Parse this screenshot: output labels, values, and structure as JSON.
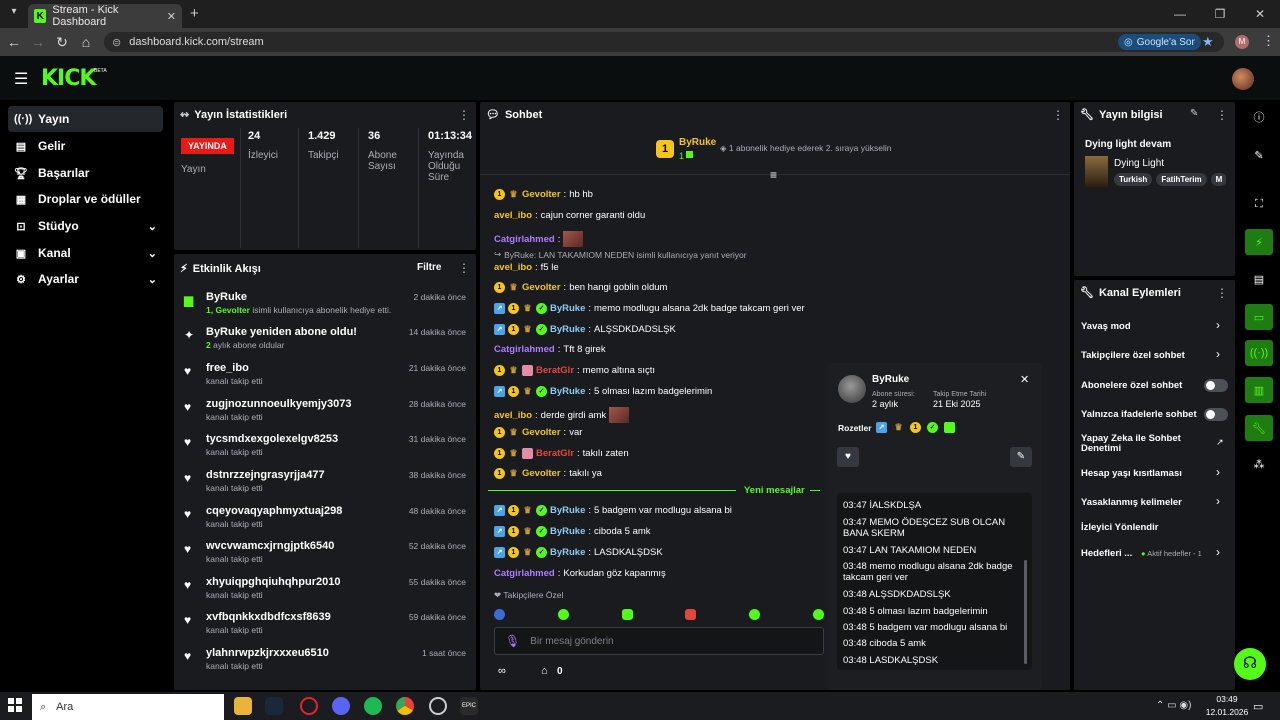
{
  "browser": {
    "tab_title": "Stream - Kick Dashboard",
    "url": "dashboard.kick.com/stream",
    "google_sor": "Google'a Sor",
    "profile_initial": "M"
  },
  "kick": {
    "logo": "KICK",
    "beta": "BETA"
  },
  "sidebar": {
    "items": [
      {
        "label": "Yayın",
        "icon": "broadcast-icon"
      },
      {
        "label": "Gelir",
        "icon": "revenue-icon"
      },
      {
        "label": "Başarılar",
        "icon": "trophy-icon"
      },
      {
        "label": "Droplar ve ödüller",
        "icon": "gift-icon"
      },
      {
        "label": "Stüdyo",
        "icon": "studio-icon"
      },
      {
        "label": "Kanal",
        "icon": "channel-icon"
      },
      {
        "label": "Ayarlar",
        "icon": "settings-icon"
      }
    ]
  },
  "stats": {
    "title": "Yayın İstatistikleri",
    "live_label": "YAYINDA",
    "status_label": "Yayın",
    "viewers": "24",
    "viewers_label": "İzleyici",
    "followers": "1.429",
    "followers_label": "Takipçi",
    "subs": "36",
    "subs_label": "Abone Sayısı",
    "duration": "01:13:34",
    "duration_label": "Yayında Olduğu Süre"
  },
  "activity": {
    "title": "Etkinlik Akışı",
    "filter": "Filtre",
    "items": [
      {
        "name": "ByRuke",
        "sub_prefix": "1, ",
        "sub_user": "Gevolter",
        "sub_suffix": " isimli kullanıcıya abonelik hediye etti.",
        "time": "2 dakika önce",
        "icon": "gift-icon"
      },
      {
        "name": "ByRuke yeniden abone oldu!",
        "sub_prefix": "2",
        "sub_user": "",
        "sub_suffix": " aylık abone oldular",
        "time": "14 dakika önce",
        "icon": "sparkle-icon"
      },
      {
        "name": "free_ibo",
        "sub_suffix": "kanalı takip etti",
        "time": "21 dakika önce",
        "icon": "heart-icon"
      },
      {
        "name": "zugjnozunnoeulkyemjy3073",
        "sub_suffix": "kanalı takip etti",
        "time": "28 dakika önce",
        "icon": "heart-icon"
      },
      {
        "name": "tycsmdxexgolexelgv8253",
        "sub_suffix": "kanalı takip etti",
        "time": "31 dakika önce",
        "icon": "heart-icon"
      },
      {
        "name": "dstnrzzejngrasyrjja477",
        "sub_suffix": "kanalı takip etti",
        "time": "38 dakika önce",
        "icon": "heart-icon"
      },
      {
        "name": "cqeyovaqyaphmyxtuaj298",
        "sub_suffix": "kanalı takip etti",
        "time": "48 dakika önce",
        "icon": "heart-icon"
      },
      {
        "name": "wvcvwamcxjrngjptk6540",
        "sub_suffix": "kanalı takip etti",
        "time": "52 dakika önce",
        "icon": "heart-icon"
      },
      {
        "name": "xhyuiqpghqiuhqhpur2010",
        "sub_suffix": "kanalı takip etti",
        "time": "55 dakika önce",
        "icon": "heart-icon"
      },
      {
        "name": "xvfbqnkkxdbdfcxsf8639",
        "sub_suffix": "kanalı takip etti",
        "time": "59 dakika önce",
        "icon": "heart-icon"
      },
      {
        "name": "ylahnrwpzkjrxxxeu6510",
        "sub_suffix": "kanalı takip etti",
        "time": "1 saat önce",
        "icon": "heart-icon"
      }
    ]
  },
  "chat": {
    "title": "Sohbet",
    "pinned_user": "ByRuke",
    "pinned_count": "1",
    "pinned_note": "1 abonelik hediye ederek 2. sıraya yükselin",
    "messages": [
      {
        "user": "Gevolter",
        "text": "hb hb",
        "badges": [
          "one",
          "crown"
        ],
        "color": "#f3c51d"
      },
      {
        "user": "avel_ibo",
        "text": "cajun corner garanti oldu",
        "badges": [],
        "color": "#f3c51d"
      },
      {
        "user": "Catgirlahmed",
        "text": "",
        "badges": [],
        "color": "#b07cff",
        "emote": true
      },
      {
        "reply": "ByRuke: LAN TAKAMIOM NEDEN isimli kullanıcıya yanıt veriyor"
      },
      {
        "user": "avel_ibo",
        "text": "f5 le",
        "badges": [],
        "color": "#f3c51d"
      },
      {
        "user": "Gevolter",
        "text": "ben hangi goblin oldum",
        "badges": [
          "one",
          "crown"
        ],
        "color": "#f3c51d"
      },
      {
        "user": "ByRuke",
        "text": "memo modlugu alsana 2dk badge takcam geri ver",
        "badges": [
          "vip",
          "one",
          "crown",
          "ver"
        ],
        "color": "#8ecbf5"
      },
      {
        "user": "ByRuke",
        "text": "ALŞSDKDADSLŞK",
        "badges": [
          "vip",
          "one",
          "crown",
          "ver"
        ],
        "color": "#8ecbf5"
      },
      {
        "user": "Catgirlahmed",
        "text": "Tft 8 girek",
        "badges": [],
        "color": "#b07cff"
      },
      {
        "user": "BeratGlr",
        "text": "memo altına sıçtı",
        "badges": [
          "one",
          "crown",
          "gift"
        ],
        "color": "#e0483f"
      },
      {
        "user": "ByRuke",
        "text": "5 olması lazım badgelerimin",
        "badges": [
          "vip",
          "one",
          "crown",
          "ver"
        ],
        "color": "#8ecbf5"
      },
      {
        "user": "avel_ibo",
        "text": "derde girdi amk",
        "badges": [],
        "color": "#f3c51d",
        "emote_after": true
      },
      {
        "user": "Gevolter",
        "text": "var",
        "badges": [
          "one",
          "crown"
        ],
        "color": "#f3c51d"
      },
      {
        "user": "BeratGlr",
        "text": "takılı zaten",
        "badges": [
          "one",
          "crown",
          "gift"
        ],
        "color": "#e0483f"
      },
      {
        "user": "Gevolter",
        "text": "takılı ya",
        "badges": [
          "one",
          "crown"
        ],
        "color": "#f3c51d"
      }
    ],
    "new_label": "Yeni mesajlar",
    "new_messages": [
      {
        "user": "ByRuke",
        "text": "5 badgem var modlugu alsana bi",
        "badges": [
          "vip",
          "one",
          "crown",
          "ver"
        ],
        "color": "#8ecbf5"
      },
      {
        "user": "ByRuke",
        "text": "ciboda 5 amk",
        "badges": [
          "vip",
          "one",
          "crown",
          "ver"
        ],
        "color": "#8ecbf5"
      },
      {
        "user": "ByRuke",
        "text": "LASDKALŞDSK",
        "badges": [
          "vip",
          "one",
          "crown",
          "ver"
        ],
        "color": "#8ecbf5"
      },
      {
        "user": "Catgirlahmed",
        "text": "Korkudan göz kapanmış",
        "badges": [],
        "color": "#b07cff"
      }
    ],
    "followers_only_label": "Takipçilere Özel",
    "input_placeholder": "Bir mesaj gönderin",
    "points": "0"
  },
  "popup": {
    "username": "ByRuke",
    "sub_label": "Abone süresi:",
    "sub_value": "2 aylık",
    "follow_label": "Takip Etme Tarihi",
    "follow_value": "21 Eki 2025",
    "badges_label": "Rozetler",
    "log": [
      "03:47 İALSKDLŞA",
      "03:47 MEMO ÖDEŞCEZ SUB OLCAN BANA SKERM",
      "03:47 LAN TAKAMIOM NEDEN",
      "03:48 memo modlugu alsana 2dk badge takcam geri ver",
      "03:48 ALŞSDKDADSLŞK",
      "03:48 5 olması lazım badgelerimin",
      "03:48 5 badgem var modlugu alsana bi",
      "03:48 ciboda 5 amk",
      "03:48 LASDKALŞDSK"
    ]
  },
  "stream_info": {
    "title": "Yayın bilgisi",
    "stream_title": "Dying light devam",
    "category": "Dying Light",
    "tags": [
      "Turkish",
      "FatihTerim",
      "M"
    ]
  },
  "channel_actions": {
    "title": "Kanal Eylemleri",
    "slow_mode": "Yavaş mod",
    "followers_only": "Takipçilere özel sohbet",
    "subs_only": "Abonelere özel sohbet",
    "emotes_only": "Yalnızca ifadelerle sohbet",
    "ai_moderation": "Yapay Zeka ile Sohbet Denetimi",
    "age_limits": "Hesap yaşı kısıtlaması",
    "banned_words": "Yasaklanmış kelimeler",
    "viewer_redirect": "İzleyici Yönlendir",
    "goals": "Hedefleri ...",
    "goals_active": "Aktif hedefler - 1"
  },
  "taskbar": {
    "search": "Ara",
    "time": "03:49",
    "date": "12.01.2026"
  },
  "colors": {
    "accent": "#53fc18",
    "live": "#e91916",
    "panel": "#191b1f"
  }
}
